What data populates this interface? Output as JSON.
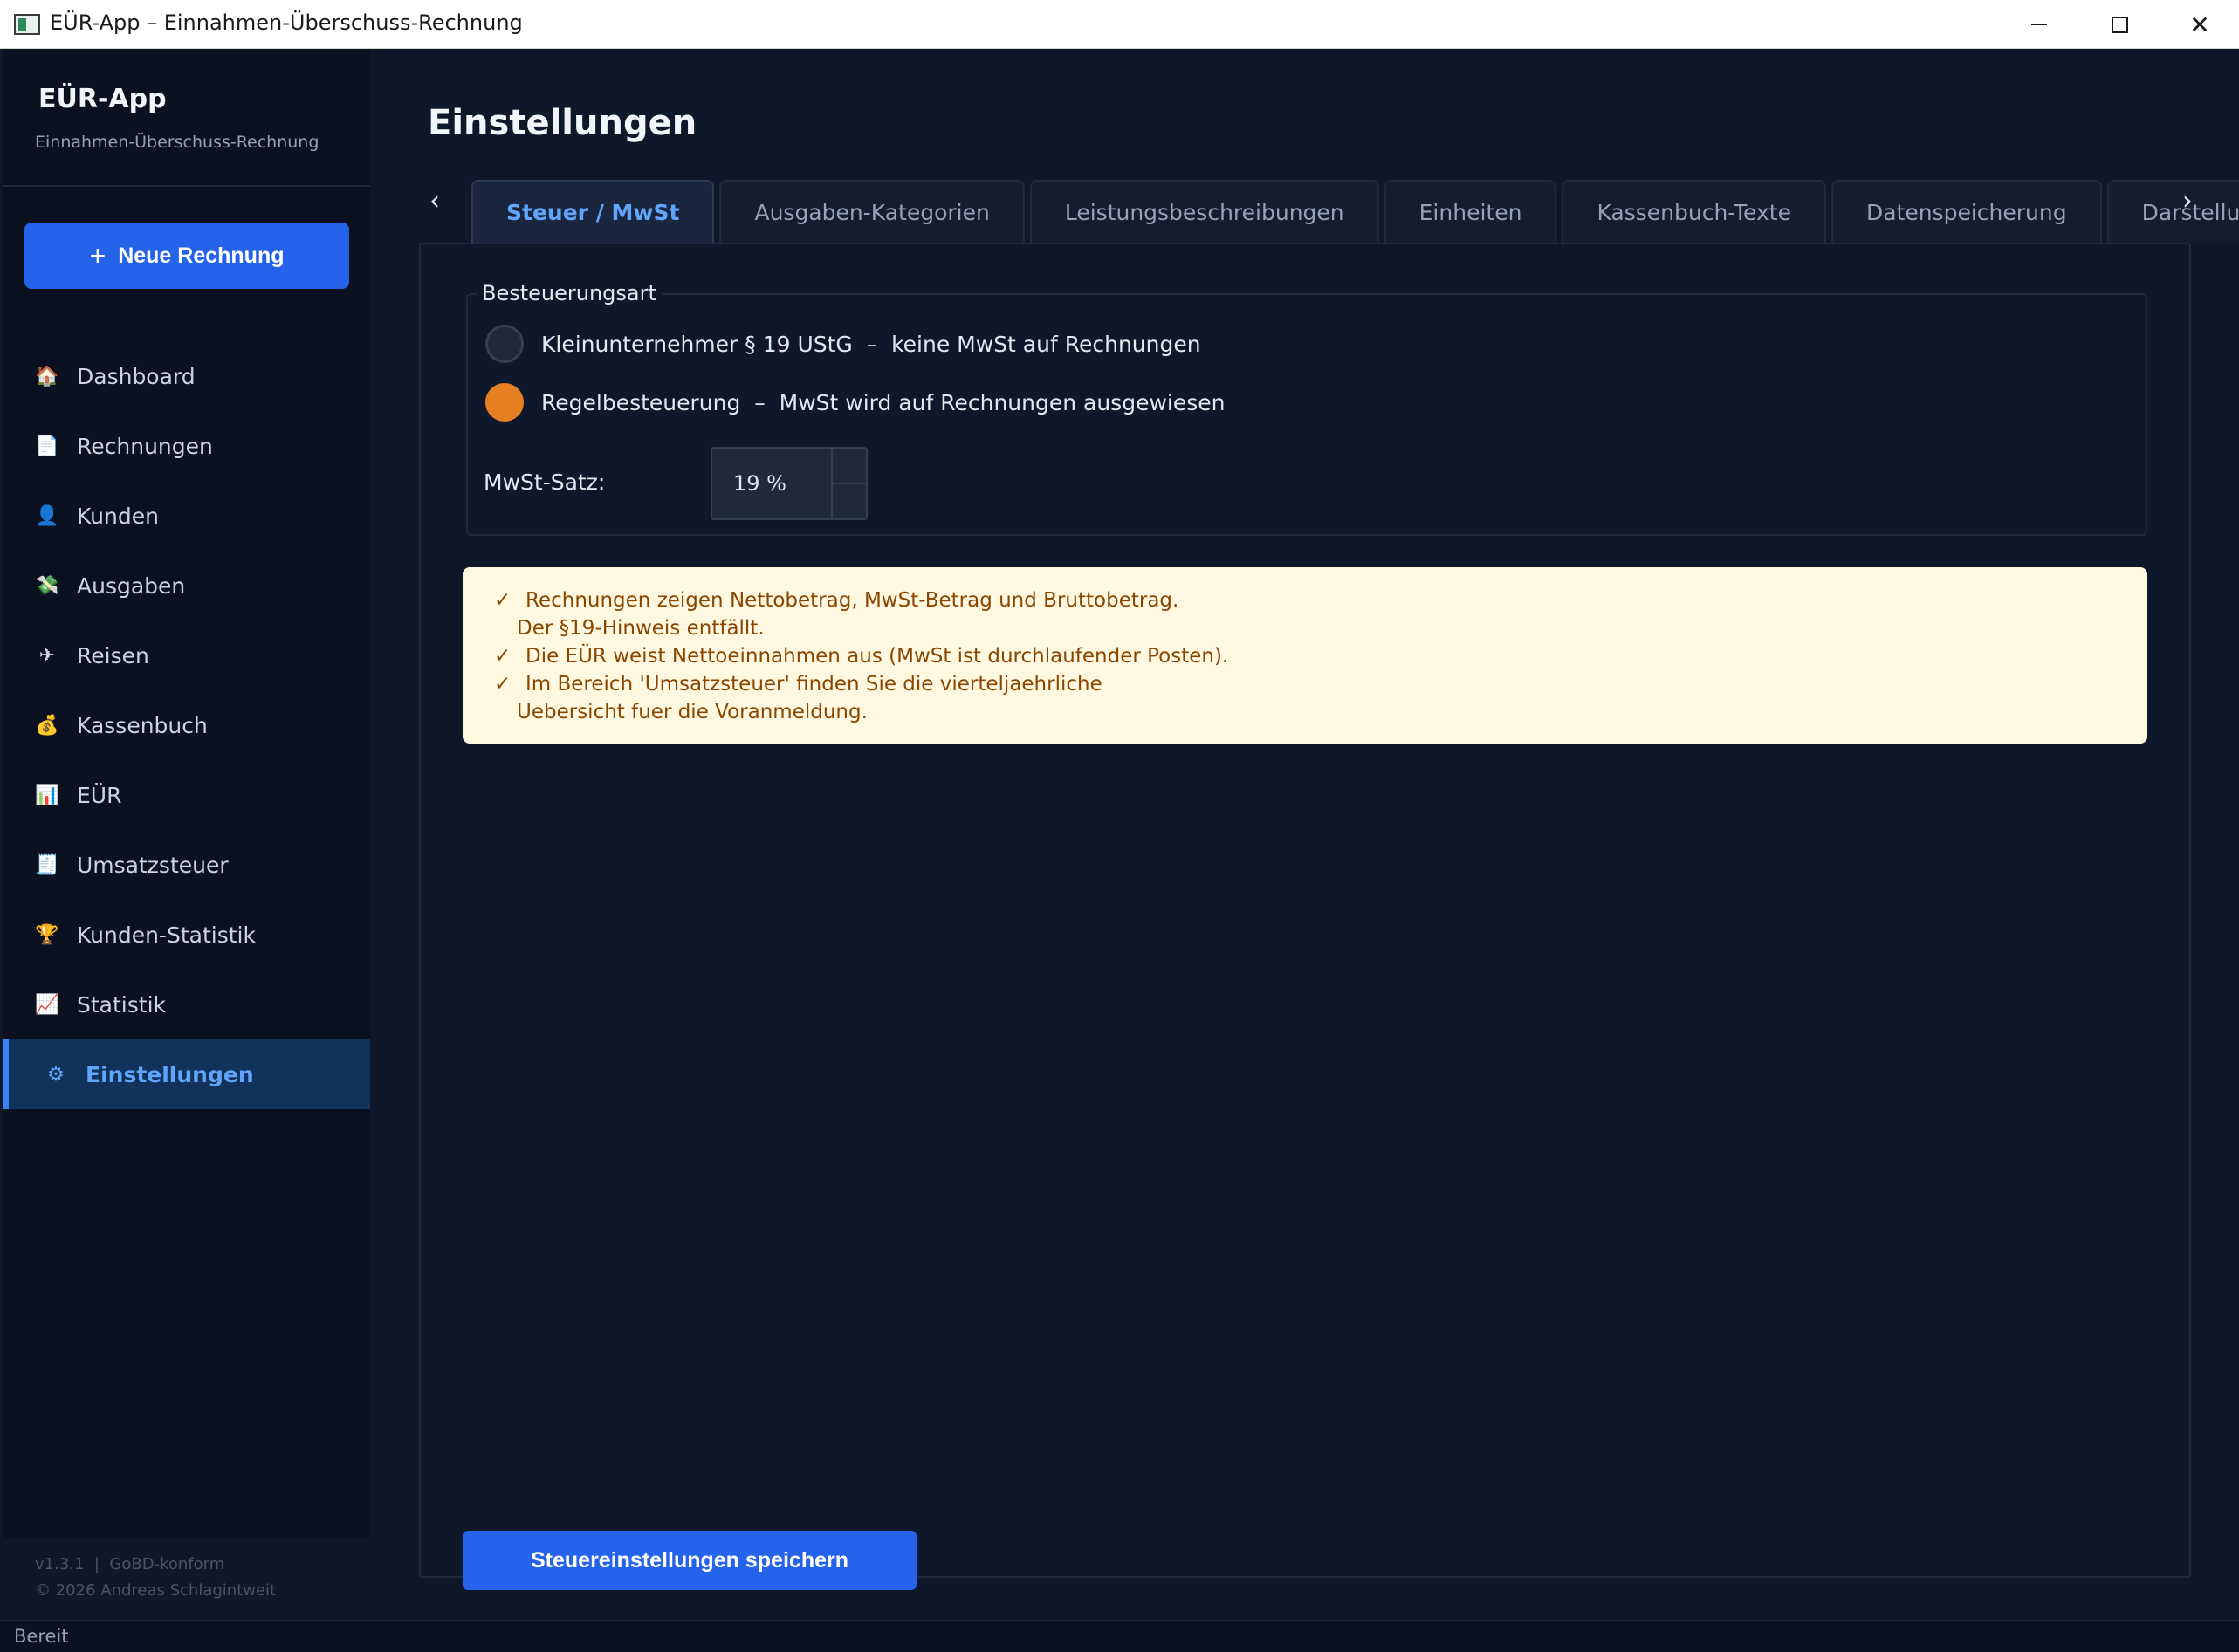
{
  "window": {
    "title": "EÜR-App – Einnahmen-Überschuss-Rechnung"
  },
  "sidebar": {
    "app_name": "EÜR-App",
    "app_subtitle": "Einnahmen-Überschuss-Rechnung",
    "new_invoice_label": "Neue Rechnung",
    "items": [
      {
        "label": "Dashboard",
        "icon": "house-icon"
      },
      {
        "label": "Rechnungen",
        "icon": "document-icon"
      },
      {
        "label": "Kunden",
        "icon": "person-icon"
      },
      {
        "label": "Ausgaben",
        "icon": "money-wings-icon"
      },
      {
        "label": "Reisen",
        "icon": "airplane-icon"
      },
      {
        "label": "Kassenbuch",
        "icon": "money-bag-icon"
      },
      {
        "label": "EÜR",
        "icon": "bar-chart-icon"
      },
      {
        "label": "Umsatzsteuer",
        "icon": "receipt-icon"
      },
      {
        "label": "Kunden-Statistik",
        "icon": "trophy-icon"
      },
      {
        "label": "Statistik",
        "icon": "line-chart-icon"
      },
      {
        "label": "Einstellungen",
        "icon": "gear-icon",
        "active": true
      }
    ],
    "footer_version": "v1.3.1  |  GoBD-konform",
    "footer_copyright": "© 2026 Andreas Schlagintweit"
  },
  "main": {
    "title": "Einstellungen",
    "tabs": [
      {
        "label": "Steuer / MwSt",
        "active": true
      },
      {
        "label": "Ausgaben-Kategorien"
      },
      {
        "label": "Leistungsbeschreibungen"
      },
      {
        "label": "Einheiten"
      },
      {
        "label": "Kassenbuch-Texte"
      },
      {
        "label": "Datenspeicherung"
      },
      {
        "label": "Darstellung"
      }
    ],
    "taxation": {
      "group_label": "Besteuerungsart",
      "option_small": "Kleinunternehmer § 19 UStG  –  keine MwSt auf Rechnungen",
      "option_regular": "Regelbesteuerung  –  MwSt wird auf Rechnungen ausgewiesen",
      "selected": "regular",
      "vat_label": "MwSt-Satz:",
      "vat_value": "19 %"
    },
    "info": {
      "check": "✓",
      "line1": "Rechnungen zeigen Nettobetrag, MwSt-Betrag und Bruttobetrag.",
      "line1b": "Der §19-Hinweis entfällt.",
      "line2": "Die EÜR weist Nettoeinnahmen aus (MwSt ist durchlaufender Posten).",
      "line3": "Im Bereich 'Umsatzsteuer' finden Sie die vierteljaehrliche",
      "line3b": "Uebersicht fuer die Voranmeldung."
    },
    "save_label": "Steuereinstellungen speichern"
  },
  "status": {
    "text": "Bereit"
  },
  "colors": {
    "accent": "#2563eb",
    "radio_selected": "#e67e22",
    "info_bg": "#fff8e1",
    "active_nav": "#11325a"
  }
}
